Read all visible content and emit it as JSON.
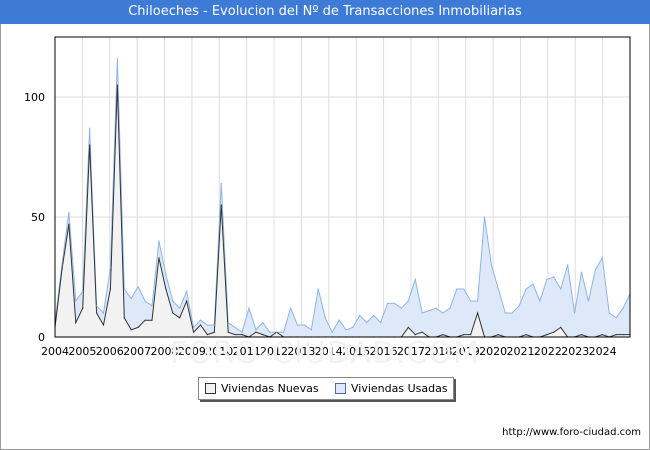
{
  "header": {
    "title": "Chiloeches - Evolucion del Nº de Transacciones Inmobiliarias"
  },
  "footer": {
    "source": "http://www.foro-ciudad.com"
  },
  "watermark": {
    "text": "FORO-CIUDAD.COM"
  },
  "colors": {
    "title_bg": "#3e7bd6",
    "nuevas_fill": "#f2f2f2",
    "nuevas_line": "#333333",
    "usadas_fill": "#dde9f8",
    "usadas_line": "#8fb4e8",
    "grid": "#dddddd"
  },
  "chart_data": {
    "type": "area",
    "title": "Chiloeches - Evolucion del Nº de Transacciones Inmobiliarias",
    "xlabel": "",
    "ylabel": "",
    "x_ticks": [
      "2004",
      "2005",
      "2006",
      "2007",
      "2008",
      "2009",
      "2010",
      "2011",
      "2012",
      "2013",
      "2014",
      "2015",
      "2016",
      "2017",
      "2018",
      "2019",
      "2020",
      "2021",
      "2022",
      "2023",
      "2024"
    ],
    "y_ticks": [
      0,
      50,
      100
    ],
    "ylim": [
      0,
      125
    ],
    "x_start": "2004 Q1",
    "x_step": "quarter",
    "grid": true,
    "legend_position": "bottom",
    "series": [
      {
        "name": "Viviendas Nuevas",
        "values": [
          4,
          28,
          47,
          6,
          12,
          80,
          10,
          5,
          20,
          105,
          8,
          3,
          4,
          7,
          7,
          33,
          20,
          10,
          8,
          15,
          2,
          5,
          1,
          2,
          55,
          2,
          1,
          1,
          0,
          2,
          1,
          0,
          2,
          0,
          0,
          0,
          0,
          0,
          0,
          0,
          0,
          0,
          0,
          0,
          0,
          0,
          0,
          0,
          0,
          0,
          0,
          4,
          1,
          2,
          0,
          0,
          1,
          0,
          0,
          1,
          1,
          10,
          0,
          0,
          1,
          0,
          0,
          0,
          1,
          0,
          0,
          1,
          2,
          4,
          0,
          0,
          1,
          0,
          0,
          1,
          0,
          1,
          1,
          1
        ]
      },
      {
        "name": "Viviendas Usadas",
        "values": [
          6,
          30,
          52,
          15,
          19,
          87,
          13,
          10,
          29,
          116,
          20,
          16,
          21,
          15,
          13,
          40,
          26,
          15,
          12,
          19,
          4,
          7,
          5,
          5,
          64,
          6,
          4,
          2,
          12,
          3,
          6,
          2,
          2,
          2,
          12,
          5,
          5,
          3,
          20,
          8,
          2,
          7,
          3,
          4,
          9,
          6,
          9,
          6,
          14,
          14,
          12,
          15,
          24,
          10,
          11,
          12,
          10,
          12,
          20,
          20,
          15,
          15,
          50,
          30,
          20,
          10,
          10,
          13,
          20,
          22,
          15,
          24,
          25,
          20,
          30,
          10,
          27,
          15,
          28,
          33,
          10,
          8,
          12,
          18
        ]
      }
    ]
  }
}
